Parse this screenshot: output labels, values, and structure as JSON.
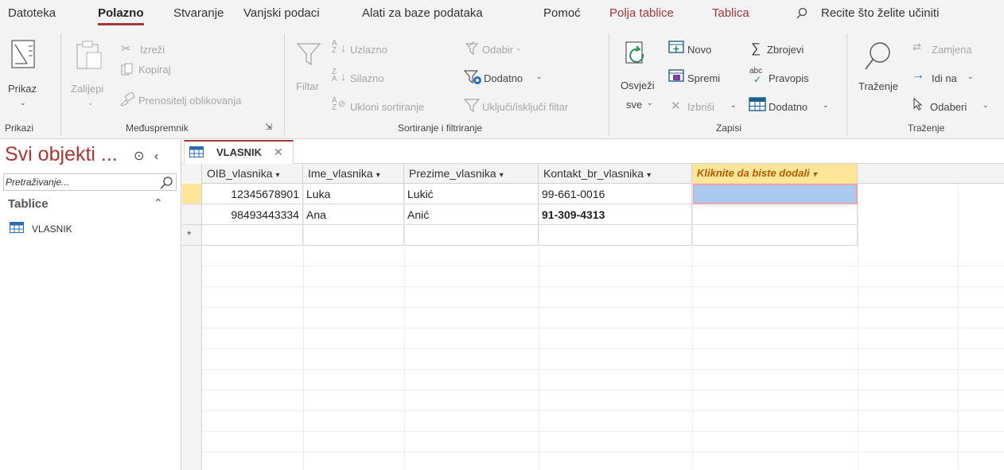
{
  "menubar": {
    "tabs": [
      "Datoteka",
      "Polazno",
      "Stvaranje",
      "Vanjski podaci",
      "Alati za baze podataka",
      "Pomoć",
      "Polja tablice",
      "Tablica"
    ],
    "tell_me": "Recite što želite učiniti"
  },
  "ribbon": {
    "views": {
      "button": "Prikaz",
      "group": "Prikazi"
    },
    "clipboard": {
      "paste": "Zalijepi",
      "cut": "Izreži",
      "copy": "Kopiraj",
      "format_painter": "Prenositelj oblikovanja",
      "group": "Međuspremnik"
    },
    "sort_filter": {
      "filter": "Filtar",
      "ascending": "Uzlazno",
      "descending": "Silazno",
      "remove_sort": "Ukloni sortiranje",
      "selection": "Odabir",
      "advanced": "Dodatno",
      "toggle_filter": "Uključi/isključi filtar",
      "group": "Sortiranje i filtriranje"
    },
    "records": {
      "refresh_line1": "Osvježi",
      "refresh_line2": "sve",
      "new": "Novo",
      "save": "Spremi",
      "delete": "Izbriši",
      "totals": "Zbrojevi",
      "spelling": "Pravopis",
      "more": "Dodatno",
      "group": "Zapisi"
    },
    "find": {
      "find": "Traženje",
      "replace": "Zamjena",
      "goto": "Idi na",
      "select": "Odaberi",
      "group": "Traženje"
    }
  },
  "nav": {
    "title": "Svi objekti ...",
    "search_placeholder": "Pretraživanje...",
    "group": "Tablice",
    "items": [
      "VLASNIK"
    ]
  },
  "document": {
    "tab_name": "VLASNIK",
    "columns": [
      "OIB_vlasnika",
      "Ime_vlasnika",
      "Prezime_vlasnika",
      "Kontakt_br_vlasnika",
      "Kliknite da biste dodali"
    ],
    "rows": [
      [
        "12345678901",
        "Luka",
        "Lukić",
        "99-661-0016",
        ""
      ],
      [
        "98493443334",
        "Ana",
        "Anić",
        "91-309-4313",
        ""
      ]
    ],
    "new_row_marker": "*"
  },
  "colors": {
    "accent": "#a4373a",
    "selection": "#a9c9ee",
    "header_highlight": "#fde59a"
  }
}
